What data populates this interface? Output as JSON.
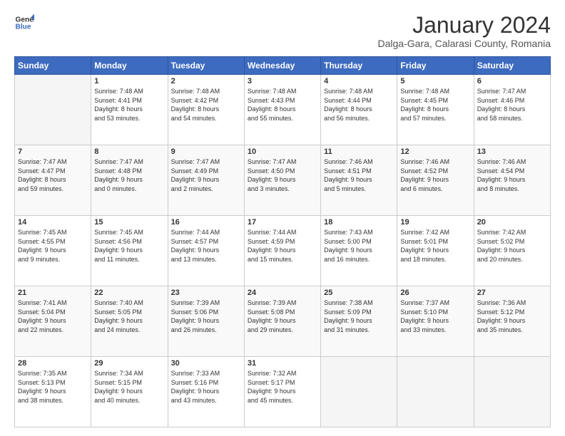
{
  "header": {
    "logo_line1": "General",
    "logo_line2": "Blue",
    "title": "January 2024",
    "subtitle": "Dalga-Gara, Calarasi County, Romania"
  },
  "days_of_week": [
    "Sunday",
    "Monday",
    "Tuesday",
    "Wednesday",
    "Thursday",
    "Friday",
    "Saturday"
  ],
  "weeks": [
    [
      {
        "day": "",
        "info": ""
      },
      {
        "day": "1",
        "info": "Sunrise: 7:48 AM\nSunset: 4:41 PM\nDaylight: 8 hours\nand 53 minutes."
      },
      {
        "day": "2",
        "info": "Sunrise: 7:48 AM\nSunset: 4:42 PM\nDaylight: 8 hours\nand 54 minutes."
      },
      {
        "day": "3",
        "info": "Sunrise: 7:48 AM\nSunset: 4:43 PM\nDaylight: 8 hours\nand 55 minutes."
      },
      {
        "day": "4",
        "info": "Sunrise: 7:48 AM\nSunset: 4:44 PM\nDaylight: 8 hours\nand 56 minutes."
      },
      {
        "day": "5",
        "info": "Sunrise: 7:48 AM\nSunset: 4:45 PM\nDaylight: 8 hours\nand 57 minutes."
      },
      {
        "day": "6",
        "info": "Sunrise: 7:47 AM\nSunset: 4:46 PM\nDaylight: 8 hours\nand 58 minutes."
      }
    ],
    [
      {
        "day": "7",
        "info": "Sunrise: 7:47 AM\nSunset: 4:47 PM\nDaylight: 8 hours\nand 59 minutes."
      },
      {
        "day": "8",
        "info": "Sunrise: 7:47 AM\nSunset: 4:48 PM\nDaylight: 9 hours\nand 0 minutes."
      },
      {
        "day": "9",
        "info": "Sunrise: 7:47 AM\nSunset: 4:49 PM\nDaylight: 9 hours\nand 2 minutes."
      },
      {
        "day": "10",
        "info": "Sunrise: 7:47 AM\nSunset: 4:50 PM\nDaylight: 9 hours\nand 3 minutes."
      },
      {
        "day": "11",
        "info": "Sunrise: 7:46 AM\nSunset: 4:51 PM\nDaylight: 9 hours\nand 5 minutes."
      },
      {
        "day": "12",
        "info": "Sunrise: 7:46 AM\nSunset: 4:52 PM\nDaylight: 9 hours\nand 6 minutes."
      },
      {
        "day": "13",
        "info": "Sunrise: 7:46 AM\nSunset: 4:54 PM\nDaylight: 9 hours\nand 8 minutes."
      }
    ],
    [
      {
        "day": "14",
        "info": "Sunrise: 7:45 AM\nSunset: 4:55 PM\nDaylight: 9 hours\nand 9 minutes."
      },
      {
        "day": "15",
        "info": "Sunrise: 7:45 AM\nSunset: 4:56 PM\nDaylight: 9 hours\nand 11 minutes."
      },
      {
        "day": "16",
        "info": "Sunrise: 7:44 AM\nSunset: 4:57 PM\nDaylight: 9 hours\nand 13 minutes."
      },
      {
        "day": "17",
        "info": "Sunrise: 7:44 AM\nSunset: 4:59 PM\nDaylight: 9 hours\nand 15 minutes."
      },
      {
        "day": "18",
        "info": "Sunrise: 7:43 AM\nSunset: 5:00 PM\nDaylight: 9 hours\nand 16 minutes."
      },
      {
        "day": "19",
        "info": "Sunrise: 7:42 AM\nSunset: 5:01 PM\nDaylight: 9 hours\nand 18 minutes."
      },
      {
        "day": "20",
        "info": "Sunrise: 7:42 AM\nSunset: 5:02 PM\nDaylight: 9 hours\nand 20 minutes."
      }
    ],
    [
      {
        "day": "21",
        "info": "Sunrise: 7:41 AM\nSunset: 5:04 PM\nDaylight: 9 hours\nand 22 minutes."
      },
      {
        "day": "22",
        "info": "Sunrise: 7:40 AM\nSunset: 5:05 PM\nDaylight: 9 hours\nand 24 minutes."
      },
      {
        "day": "23",
        "info": "Sunrise: 7:39 AM\nSunset: 5:06 PM\nDaylight: 9 hours\nand 26 minutes."
      },
      {
        "day": "24",
        "info": "Sunrise: 7:39 AM\nSunset: 5:08 PM\nDaylight: 9 hours\nand 29 minutes."
      },
      {
        "day": "25",
        "info": "Sunrise: 7:38 AM\nSunset: 5:09 PM\nDaylight: 9 hours\nand 31 minutes."
      },
      {
        "day": "26",
        "info": "Sunrise: 7:37 AM\nSunset: 5:10 PM\nDaylight: 9 hours\nand 33 minutes."
      },
      {
        "day": "27",
        "info": "Sunrise: 7:36 AM\nSunset: 5:12 PM\nDaylight: 9 hours\nand 35 minutes."
      }
    ],
    [
      {
        "day": "28",
        "info": "Sunrise: 7:35 AM\nSunset: 5:13 PM\nDaylight: 9 hours\nand 38 minutes."
      },
      {
        "day": "29",
        "info": "Sunrise: 7:34 AM\nSunset: 5:15 PM\nDaylight: 9 hours\nand 40 minutes."
      },
      {
        "day": "30",
        "info": "Sunrise: 7:33 AM\nSunset: 5:16 PM\nDaylight: 9 hours\nand 43 minutes."
      },
      {
        "day": "31",
        "info": "Sunrise: 7:32 AM\nSunset: 5:17 PM\nDaylight: 9 hours\nand 45 minutes."
      },
      {
        "day": "",
        "info": ""
      },
      {
        "day": "",
        "info": ""
      },
      {
        "day": "",
        "info": ""
      }
    ]
  ]
}
